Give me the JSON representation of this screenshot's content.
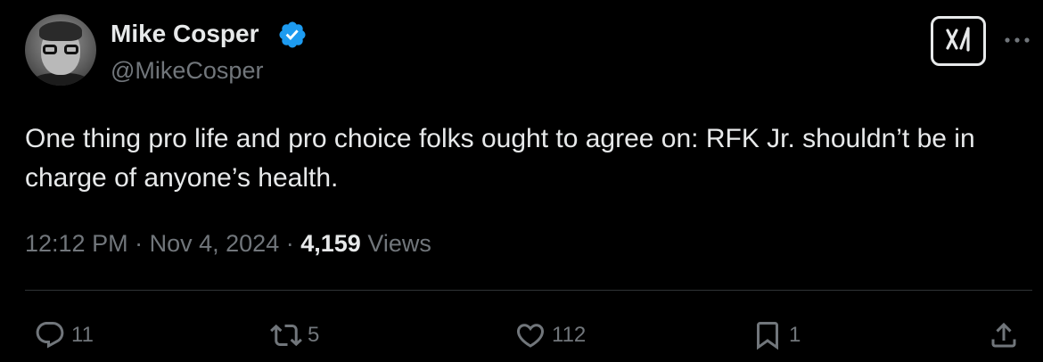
{
  "author": {
    "display_name": "Mike Cosper",
    "handle": "@MikeCosper",
    "verified": true
  },
  "tweet": {
    "text": "One thing pro life and pro choice folks ought to agree on: RFK Jr. shouldn’t be in charge of anyone’s health.",
    "time": "12:12 PM",
    "date": "Nov 4, 2024",
    "separator": "·",
    "views_count": "4,159",
    "views_label": "Views"
  },
  "actions": {
    "replies": "11",
    "reposts": "5",
    "likes": "112",
    "bookmarks": "1"
  },
  "icons": {
    "verified": "verified-badge-icon",
    "grok": "grok-icon",
    "more": "more-icon",
    "reply": "reply-icon",
    "repost": "repost-icon",
    "like": "heart-icon",
    "bookmark": "bookmark-icon",
    "share": "share-icon"
  },
  "colors": {
    "background": "#000000",
    "primary_text": "#e7e9ea",
    "secondary_text": "#71767b",
    "verified_blue": "#1d9bf0",
    "divider": "#2f3336"
  }
}
